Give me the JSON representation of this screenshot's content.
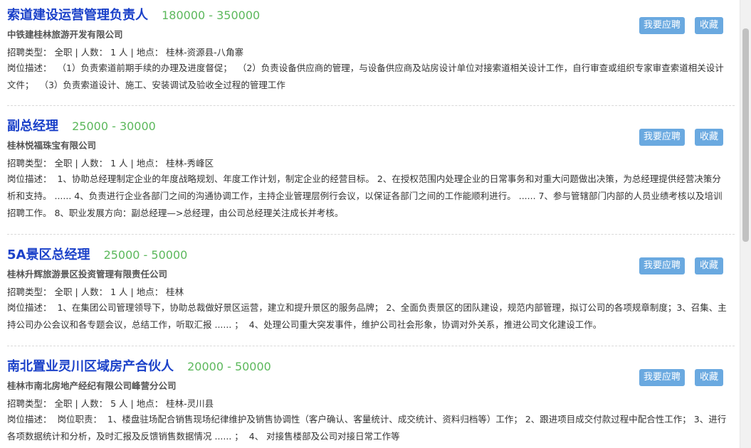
{
  "labels": {
    "apply_button": "我要应聘",
    "favorite_button": "收藏",
    "type_prefix": "招聘类型：",
    "desc_prefix": "岗位描述：",
    "count_prefix": "人数："
  },
  "jobs": [
    {
      "title": "索道建设运营管理负责人",
      "salary": "180000 - 350000",
      "company": "中铁建桂林旅游开发有限公司",
      "meta": "招聘类型：  全职 | 人数：  1 人 | 地点：  桂林-资源县-八角寨",
      "desc": "岗位描述：  （1）负责索道前期手续的办理及进度督促；  （2）负责设备供应商的管理，与设备供应商及站房设计单位对接索道相关设计工作，自行审查或组织专家审查索道相关设计文件；  （3）负责索道设计、施工、安装调试及验收全过程的管理工作"
    },
    {
      "title": "副总经理",
      "salary": "25000 - 30000",
      "company": "桂林悦福珠宝有限公司",
      "meta": "招聘类型：  全职 | 人数：  1 人 | 地点：  桂林-秀峰区",
      "desc": "岗位描述：  1、协助总经理制定企业的年度战略规划、年度工作计划，制定企业的经营目标。 2、在授权范围内处理企业的日常事务和对重大问题做出决策，为总经理提供经营决策分析和支持。 ...... 4、负责进行企业各部门之间的沟通协调工作，主持企业管理层例行会议，以保证各部门之间的工作能顺利进行。 ...... 7、参与管辖部门内部的人员业绩考核以及培训招聘工作。 8、职业发展方向：副总经理—>总经理，由公司总经理关注成长并考核。"
    },
    {
      "title": "5A景区总经理",
      "salary": "25000 - 50000",
      "company": "桂林升辉旅游景区投资管理有限责任公司",
      "meta": "招聘类型：  全职 | 人数：  1 人 | 地点：  桂林",
      "desc": "岗位描述：  1、在集团公司管理领导下，协助总裁做好景区运营，建立和提升景区的服务品牌； 2、全面负责景区的团队建设，规范内部管理，拟订公司的各项规章制度；3、召集、主持公司办公会议和各专题会议，总结工作，听取汇报 ...... ；  4、处理公司重大突发事件，维护公司社会形象，协调对外关系，推进公司文化建设工作。"
    },
    {
      "title": "南北置业灵川区域房产合伙人",
      "salary": "20000 - 50000",
      "company": "桂林市南北房地产经纪有限公司峰营分公司",
      "meta": "招聘类型：  全职 | 人数：  5 人 | 地点：  桂林-灵川县",
      "desc": "岗位描述：  岗位职责：  1、楼盘驻场配合销售现场纪律维护及销售协调性（客户确认、客量统计、成交统计、资料归档等）工作； 2、跟进项目成交付款过程中配合性工作； 3、进行各项数据统计和分析，及时汇报及反馈销售数据情况 ...... ；  4、 对接售楼部及公司对接日常工作等"
    }
  ],
  "colors": {
    "title": "#1b41c9",
    "salary": "#5cb85c",
    "button": "#6aa9e0"
  }
}
